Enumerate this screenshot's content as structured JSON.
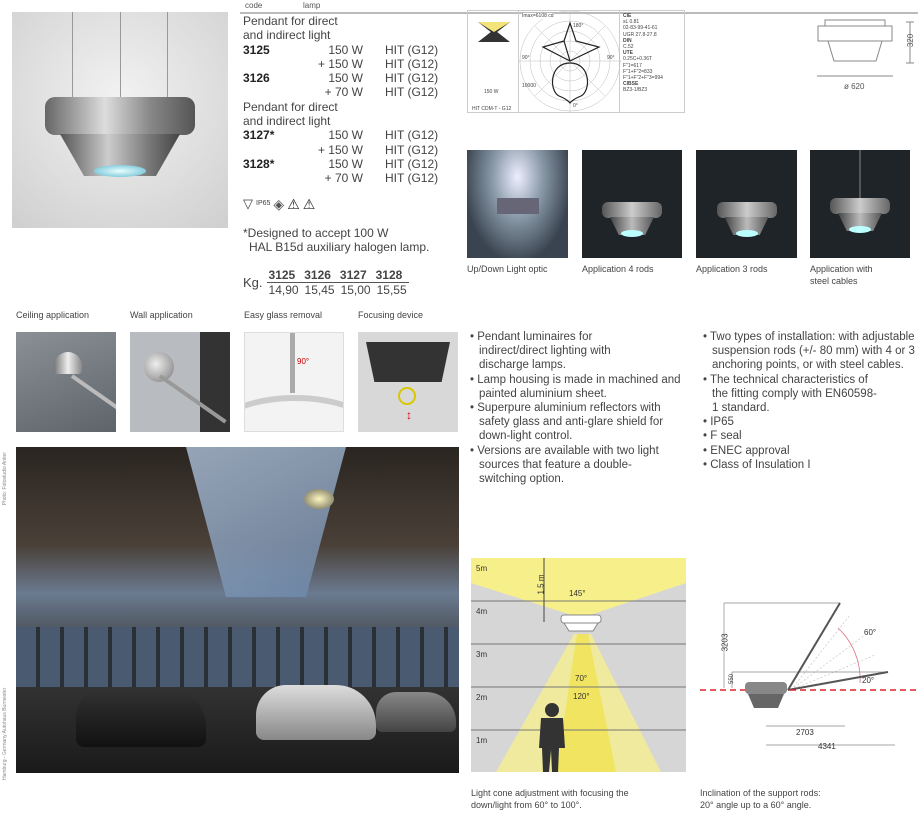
{
  "header": {
    "code_label": "code",
    "lamp_label": "lamp"
  },
  "specs": {
    "group1_title": [
      "Pendant for direct",
      "and indirect light"
    ],
    "group1": [
      {
        "code": "3125",
        "power": "150 W",
        "lamp": "HIT (G12)"
      },
      {
        "code": "",
        "power": "+ 150 W",
        "lamp": "HIT (G12)"
      },
      {
        "code": "3126",
        "power": "150 W",
        "lamp": "HIT (G12)"
      },
      {
        "code": "",
        "power": "+  70 W",
        "lamp": "HIT (G12)"
      }
    ],
    "group2_title": [
      "Pendant for direct",
      "and indirect light"
    ],
    "group2": [
      {
        "code": "3127*",
        "power": "150 W",
        "lamp": "HIT (G12)"
      },
      {
        "code": "",
        "power": "+ 150 W",
        "lamp": "HIT (G12)"
      },
      {
        "code": "3128*",
        "power": "150 W",
        "lamp": "HIT (G12)"
      },
      {
        "code": "",
        "power": "+  70 W",
        "lamp": "HIT (G12)"
      }
    ],
    "ip_label": "IP65",
    "footnote": [
      "*Designed to accept 100 W",
      "HAL B15d auxiliary halogen lamp."
    ],
    "weight_label": "Kg.",
    "weight_codes": [
      "3125",
      "3126",
      "3127",
      "3128"
    ],
    "weight_values": [
      "14,90",
      "15,45",
      "15,00",
      "15,55"
    ]
  },
  "photometric": {
    "imax": "Imax=6108 cd",
    "angle_top": "180°",
    "angle_left": "90°",
    "angle_right": "90°",
    "angle_bottom": "0°",
    "scale": "10000",
    "power": "150 W",
    "lamp": "HIT CDM-T - G12",
    "cie_title": "CIE",
    "cie": [
      "sL 0.81",
      "02-83-99-41-61",
      "UGR 27.8-27.8"
    ],
    "din_title": "DIN",
    "din": [
      "C.52"
    ],
    "ute_title": "UTE",
    "ute": [
      "0.25C+0.36T",
      "F\"1=617",
      "F\"1+F\"2=833",
      "F\"1+F\"2+F\"3=994"
    ],
    "cibse_title": "CIBSE",
    "cibse": [
      "BZ3-1/BZ3"
    ]
  },
  "dimensions": {
    "height": "320",
    "diameter": "ø 620"
  },
  "applications": [
    {
      "caption": "Up/Down Light optic"
    },
    {
      "caption": "Application 4 rods"
    },
    {
      "caption": "Application 3 rods"
    },
    {
      "caption": "Application with steel cables"
    }
  ],
  "details": [
    {
      "caption": "Ceiling application"
    },
    {
      "caption": "Wall application"
    },
    {
      "caption": "Easy glass removal",
      "angle": "90°"
    },
    {
      "caption": "Focusing device"
    }
  ],
  "photo_credit": {
    "photographer": "Photo: Fotostudio Anker",
    "location": "Hamburg - Germany Autohaus Burmester"
  },
  "features_left": [
    "Pendant luminaires for indirect/direct lighting with discharge lamps.",
    "Lamp  housing is made in machined and painted aluminium sheet.",
    "Superpure aluminium reflectors with safety glass and anti-glare shield for down-light control.",
    "Versions are available with two light sources that feature a double-switching option."
  ],
  "features_right": [
    "Two types of installation: with adjustable suspension rods (+/- 80 mm) with 4 or 3 anchoring points, or with steel cables.",
    "The technical characteristics of the fitting comply with EN60598-1 standard.",
    "IP65",
    "F seal",
    "ENEC approval",
    "Class of Insulation I"
  ],
  "cone_diagram": {
    "levels": [
      "5m",
      "4m",
      "3m",
      "2m",
      "1m"
    ],
    "height_label": "1,5 m",
    "angle_up": "145°",
    "angle_narrow": "70°",
    "angle_wide": "120°",
    "caption": [
      "Light cone adjustment with focusing the",
      "down/light from 60° to 100°."
    ]
  },
  "rod_diagram": {
    "height": "3203",
    "offset": "550",
    "angle_max": "60°",
    "angle_min": "20°",
    "width_short": "2703",
    "width_long": "4341",
    "caption": [
      "Inclination of the support rods:",
      "20° angle up to a 60° angle."
    ]
  },
  "colors": {
    "cone_yellow": "#f7f08a",
    "grid_gray": "#d6d6d6",
    "dash_red": "#e0202a"
  }
}
